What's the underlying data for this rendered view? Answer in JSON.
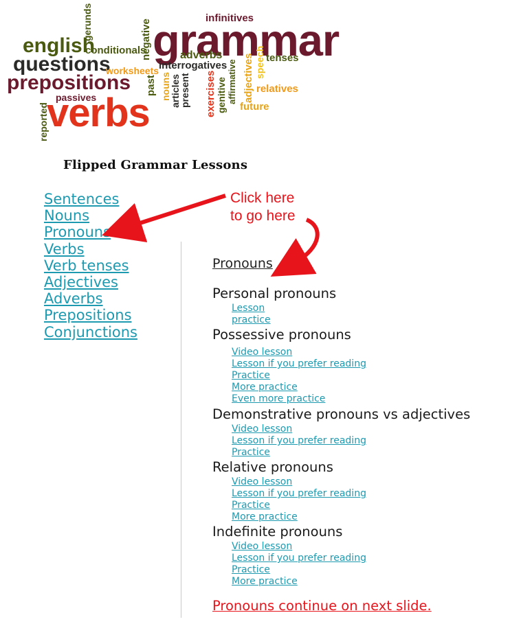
{
  "word_cloud": {
    "words": {
      "infinitives": "infinitives",
      "grammar": "grammar",
      "gerunds": "gerunds",
      "negative": "negative",
      "english": "english",
      "conditionals": "conditionals",
      "adverbs": "adverbs",
      "questions": "questions",
      "interrogatives": "interrogatives",
      "tenses": "tenses",
      "worksheets": "worksheets",
      "prepositions": "prepositions",
      "past": "past",
      "nouns": "nouns",
      "articles": "articles",
      "present": "present",
      "exercises": "exercises",
      "genitive": "genitive",
      "affirmative": "affirmative",
      "adjectives": "adjectives",
      "speech": "speech",
      "relatives": "relatives",
      "passives": "passives",
      "future": "future",
      "verbs": "verbs",
      "reported": "reported"
    },
    "colors": {
      "maroon": "#6b1a2e",
      "olive": "#4a5a10",
      "dark": "#2a2a28",
      "orange": "#f09a18",
      "red": "#e2341c",
      "amber": "#e8a415",
      "yellow": "#f2c21c"
    }
  },
  "page": {
    "heading": "Flipped Grammar Lessons"
  },
  "nav": {
    "items": [
      {
        "label": "Sentences"
      },
      {
        "label": "Nouns"
      },
      {
        "label": "Pronouns"
      },
      {
        "label": "Verbs"
      },
      {
        "label": "Verb tenses"
      },
      {
        "label": "Adjectives"
      },
      {
        "label": "Adverbs"
      },
      {
        "label": "Prepositions"
      },
      {
        "label": "Conjunctions"
      }
    ]
  },
  "annotation": {
    "line1": "Click here",
    "line2": "to go here",
    "color": "#e8141b"
  },
  "content": {
    "title": "Pronouns",
    "groups": [
      {
        "title": "Personal pronouns",
        "links": [
          "Lesson",
          "practice"
        ]
      },
      {
        "title": "Possessive pronouns",
        "links": [
          "Video lesson",
          "Lesson if you prefer reading",
          "Practice",
          "More practice",
          "Even more practice"
        ]
      },
      {
        "title": "Demonstrative pronouns vs adjectives",
        "links": [
          "Video lesson",
          "Lesson if you prefer reading",
          "Practice"
        ]
      },
      {
        "title": "Relative pronouns",
        "links": [
          "Video lesson",
          "Lesson if you prefer reading",
          "Practice",
          "More practice"
        ]
      },
      {
        "title": "Indefinite pronouns",
        "links": [
          "Video lesson",
          "Lesson if you prefer reading",
          "Practice",
          "More practice"
        ]
      }
    ],
    "continue": "Pronouns continue on next slide."
  },
  "colors": {
    "link": "#1e9ab0",
    "accent_red": "#e8141b"
  }
}
